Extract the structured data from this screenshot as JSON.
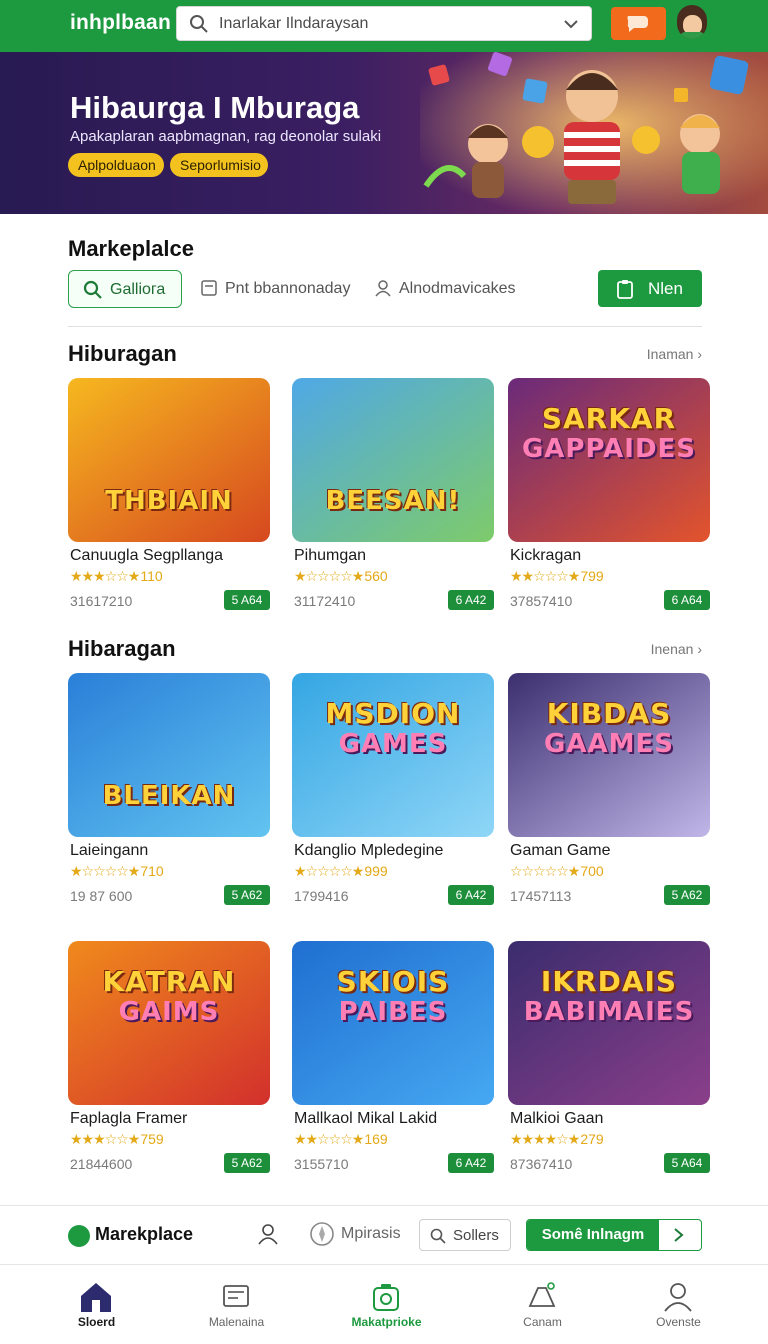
{
  "app": {
    "brand": "inhplbaan",
    "search_placeholder": "Inarlakar Ilndaraysan"
  },
  "hero": {
    "title": "Hibaurga I Mburaga",
    "subtitle": "Apakaplaran aapbmagnan, rag deonolar sulaki",
    "chips": [
      "Aplpolduaon",
      "Seporlumisio"
    ]
  },
  "marketplace": {
    "title": "Markeplalce",
    "tabs": [
      {
        "label": "Galliога",
        "icon": "search-icon"
      },
      {
        "label": "Pnt bbannonaday",
        "icon": "calendar-icon"
      },
      {
        "label": "Alnodmavicakes",
        "icon": "user-icon"
      }
    ],
    "new_button": "Nlen"
  },
  "sections": [
    {
      "title": "Hiburagan",
      "more": "Inaman",
      "items": [
        {
          "name": "Canuugla Segpllanga",
          "stars": "★★★☆☆",
          "rating": "★110",
          "count": "31617210",
          "price": "5 A64",
          "art": {
            "word1": "THBIAIN",
            "word2": "",
            "bg1": "#f6b81f",
            "bg2": "#d6481f"
          }
        },
        {
          "name": "Pihumgan",
          "stars": "★☆☆☆☆",
          "rating": "★560",
          "count": "31172410",
          "price": "6 A42",
          "art": {
            "word1": "BEESAN!",
            "word2": "",
            "bg1": "#4fa8e6",
            "bg2": "#7ecb6a"
          }
        },
        {
          "name": "Kickragan",
          "stars": "★★☆☆☆",
          "rating": "★799",
          "count": "37857410",
          "price": "6 A64",
          "art": {
            "word1": "SARKAR",
            "word2": "GAPPAIDES",
            "bg1": "#6a2a7a",
            "bg2": "#e3542c"
          }
        }
      ]
    },
    {
      "title": "Hibaragan",
      "more": "Inenan",
      "items": [
        {
          "name": "Laieingann",
          "stars": "★☆☆☆☆",
          "rating": "★710",
          "count": "19 87 600",
          "price": "5 A62",
          "art": {
            "word1": "BLEIKAN",
            "word2": "",
            "bg1": "#2a7fd8",
            "bg2": "#62c4f0"
          }
        },
        {
          "name": "Kdanglio Mpledegine",
          "stars": "★☆☆☆☆",
          "rating": "★999",
          "count": "1799416",
          "price": "6 A42",
          "art": {
            "word1": "MSDION",
            "word2": "GAMES",
            "bg1": "#34a6e3",
            "bg2": "#8fd6f7"
          }
        },
        {
          "name": "Gaman Game",
          "stars": "☆☆☆☆☆",
          "rating": "★700",
          "count": "17457113",
          "price": "5 A62",
          "art": {
            "word1": "KIBDAS",
            "word2": "GAAMES",
            "bg1": "#3b2f6f",
            "bg2": "#c0b6e8"
          }
        }
      ]
    },
    {
      "title": "",
      "more": "",
      "items": [
        {
          "name": "Faplagla Framer",
          "stars": "★★★☆☆",
          "rating": "★759",
          "count": "21844600",
          "price": "5 A62",
          "art": {
            "word1": "KATRAN",
            "word2": "GAIMS",
            "bg1": "#f08a1c",
            "bg2": "#d2302c"
          }
        },
        {
          "name": "Mallkaol Mikal Lakid",
          "stars": "★★☆☆☆",
          "rating": "★169",
          "count": "3155710",
          "price": "6 A42",
          "art": {
            "word1": "SKIOIS",
            "word2": "PAIBES",
            "bg1": "#1f6fd0",
            "bg2": "#46a8f2"
          }
        },
        {
          "name": "Malkioi Gaan",
          "stars": "★★★★☆",
          "rating": "★279",
          "count": "87367410",
          "price": "5 A64",
          "art": {
            "word1": "IKRDAIS",
            "word2": "BABIMAIES",
            "bg1": "#3a2c6e",
            "bg2": "#8b3f8a"
          }
        }
      ]
    }
  ],
  "toolbar": {
    "title": "Marekplace",
    "explore": "Mpirasis",
    "sellers": "Sollers",
    "cta": "Somê Inlnagm"
  },
  "bottom_nav": [
    {
      "label": "Sloerd",
      "icon": "home-icon"
    },
    {
      "label": "Malenaina",
      "icon": "inbox-icon"
    },
    {
      "label": "Makatprioke",
      "icon": "marketplace-icon"
    },
    {
      "label": "Canam",
      "icon": "game-icon"
    },
    {
      "label": "Ovenste",
      "icon": "profile-icon"
    }
  ],
  "colors": {
    "primary_green": "#1d9a3f",
    "accent_orange": "#f26a1c",
    "chip_yellow": "#f4c21f",
    "hero_purple": "#281a52"
  }
}
